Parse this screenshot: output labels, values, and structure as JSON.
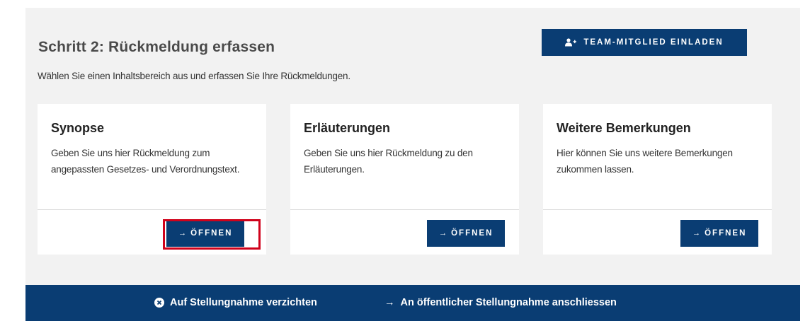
{
  "header": {
    "title": "Schritt 2: Rückmeldung erfassen",
    "subtitle": "Wählen Sie einen Inhaltsbereich aus und erfassen Sie Ihre Rückmeldungen.",
    "invite_label": "TEAM-MITGLIED EINLADEN"
  },
  "cards": [
    {
      "title": "Synopse",
      "description": "Geben Sie uns hier Rückmeldung zum angepassten Gesetzes- und Verordnungstext.",
      "button_label": "ÖFFNEN"
    },
    {
      "title": "Erläuterungen",
      "description": "Geben Sie uns hier Rückmeldung zu den Erläuterungen.",
      "button_label": "ÖFFNEN"
    },
    {
      "title": "Weitere Bemerkungen",
      "description": "Hier können Sie uns weitere Bemerkungen zukommen lassen.",
      "button_label": "ÖFFNEN"
    }
  ],
  "footer": {
    "decline_label": "Auf Stellungnahme verzichten",
    "join_label": "An öffentlicher Stellungnahme anschliessen"
  },
  "colors": {
    "primary": "#0a3d73",
    "panel_bg": "#f2f2f2",
    "highlight": "#d0021b"
  }
}
